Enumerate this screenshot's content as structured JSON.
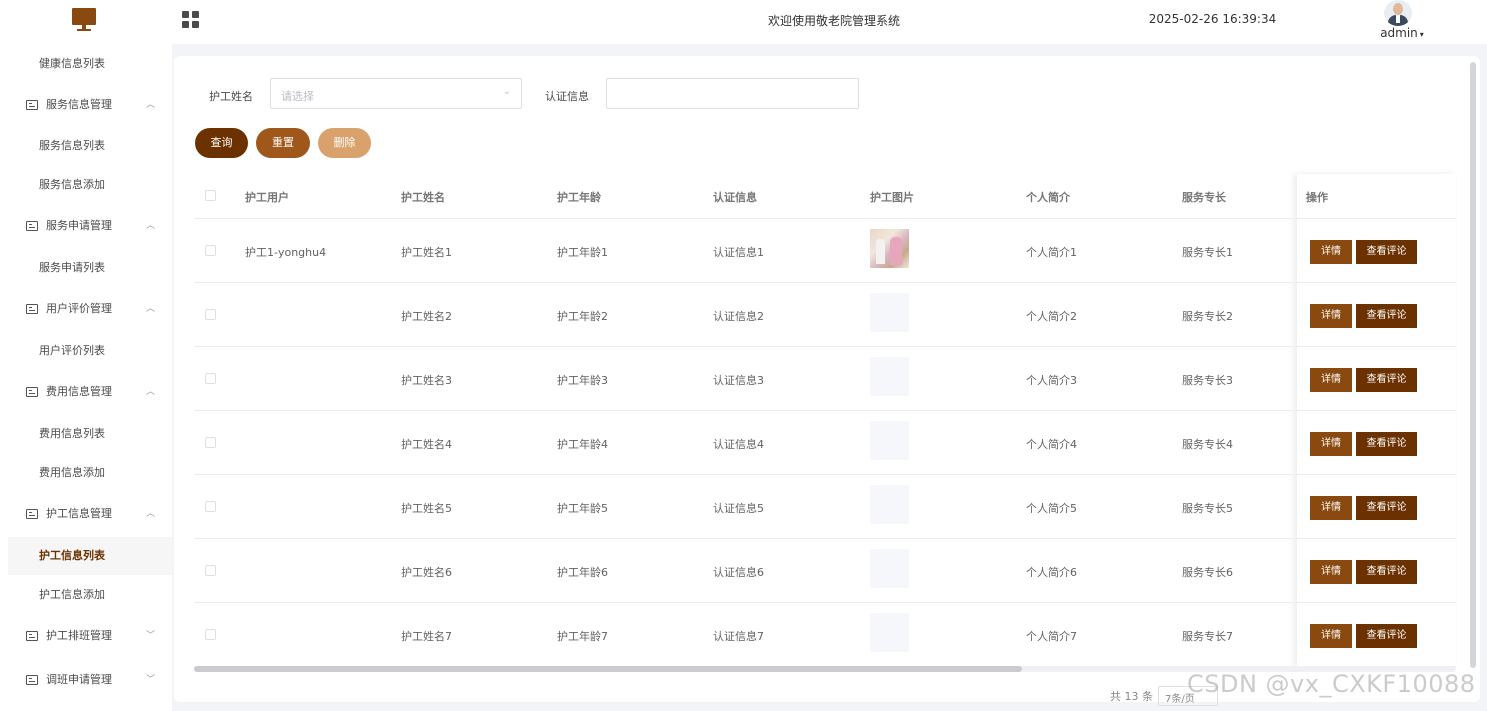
{
  "header": {
    "title": "欢迎使用敬老院管理系统",
    "datetime": "2025-02-26 16:39:34",
    "user": "admin"
  },
  "sidebar": {
    "items": [
      {
        "label": "健康信息列表",
        "type": "sub"
      },
      {
        "label": "服务信息管理",
        "type": "group",
        "caret": "^"
      },
      {
        "label": "服务信息列表",
        "type": "sub"
      },
      {
        "label": "服务信息添加",
        "type": "sub"
      },
      {
        "label": "服务申请管理",
        "type": "group",
        "caret": "^"
      },
      {
        "label": "服务申请列表",
        "type": "sub"
      },
      {
        "label": "用户评价管理",
        "type": "group",
        "caret": "^"
      },
      {
        "label": "用户评价列表",
        "type": "sub"
      },
      {
        "label": "费用信息管理",
        "type": "group",
        "caret": "^"
      },
      {
        "label": "费用信息列表",
        "type": "sub"
      },
      {
        "label": "费用信息添加",
        "type": "sub"
      },
      {
        "label": "护工信息管理",
        "type": "group",
        "caret": "^"
      },
      {
        "label": "护工信息列表",
        "type": "sub",
        "active": true
      },
      {
        "label": "护工信息添加",
        "type": "sub"
      },
      {
        "label": "护工排班管理",
        "type": "group",
        "caret": "v"
      },
      {
        "label": "调班申请管理",
        "type": "group",
        "caret": "v"
      }
    ]
  },
  "filters": {
    "name_label": "护工姓名",
    "name_placeholder": "请选择",
    "cert_label": "认证信息",
    "cert_value": ""
  },
  "buttons": {
    "query": "查询",
    "reset": "重置",
    "delete": "删除"
  },
  "colors": {
    "query": "#6b3200",
    "reset": "#a0581a",
    "delete": "#d9a26d",
    "detail": "#8a4a0f",
    "review": "#6b3200",
    "active_text": "#6b3200"
  },
  "table": {
    "columns": [
      "护工用户",
      "护工姓名",
      "护工年龄",
      "认证信息",
      "护工图片",
      "个人简介",
      "服务专长",
      "操作"
    ],
    "rows": [
      {
        "user": "护工1-yonghu4",
        "name": "护工姓名1",
        "age": "护工年龄1",
        "cert": "认证信息1",
        "photo": true,
        "intro": "个人简介1",
        "skill": "服务专长1"
      },
      {
        "user": "",
        "name": "护工姓名2",
        "age": "护工年龄2",
        "cert": "认证信息2",
        "photo": false,
        "intro": "个人简介2",
        "skill": "服务专长2"
      },
      {
        "user": "",
        "name": "护工姓名3",
        "age": "护工年龄3",
        "cert": "认证信息3",
        "photo": false,
        "intro": "个人简介3",
        "skill": "服务专长3"
      },
      {
        "user": "",
        "name": "护工姓名4",
        "age": "护工年龄4",
        "cert": "认证信息4",
        "photo": false,
        "intro": "个人简介4",
        "skill": "服务专长4"
      },
      {
        "user": "",
        "name": "护工姓名5",
        "age": "护工年龄5",
        "cert": "认证信息5",
        "photo": false,
        "intro": "个人简介5",
        "skill": "服务专长5"
      },
      {
        "user": "",
        "name": "护工姓名6",
        "age": "护工年龄6",
        "cert": "认证信息6",
        "photo": false,
        "intro": "个人简介6",
        "skill": "服务专长6"
      },
      {
        "user": "",
        "name": "护工姓名7",
        "age": "护工年龄7",
        "cert": "认证信息7",
        "photo": false,
        "intro": "个人简介7",
        "skill": "服务专长7"
      }
    ],
    "action_detail": "详情",
    "action_review": "查看评论"
  },
  "pagination": {
    "total_text": "共 13 条",
    "page_size": "7条/页"
  },
  "watermark": "CSDN @vx_CXKF10088"
}
